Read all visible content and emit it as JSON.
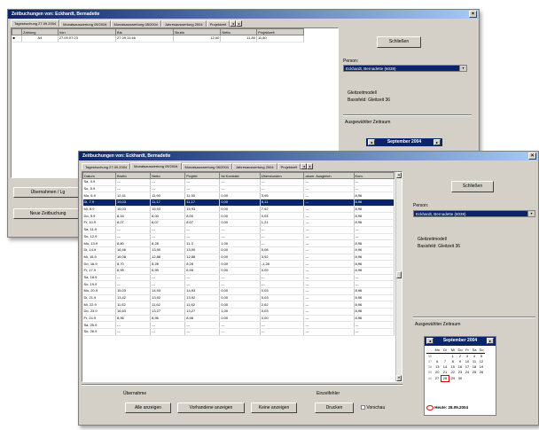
{
  "back_window": {
    "title": "Zeitbuchungen von: Eckhardt, Bernadette",
    "tabs": [
      "Tagesbuchung 27.09.2004",
      "Monatsauswertung 09/2004",
      "Monatsauswertung 08/2004",
      "Jahresauswertung 2004",
      "Projektzeit"
    ],
    "table": {
      "columns": [
        "",
        "Zahlung",
        "Von",
        "Bis",
        "Brutto",
        "Netto",
        "Projektzeit"
      ],
      "rows": [
        [
          "",
          "A4",
          "27.09.07:23",
          "27.09.11:46",
          "12,00",
          "11,80",
          "11,80"
        ]
      ]
    },
    "buttons": {
      "schliessen": "Schließen",
      "left1": "Übernahmen / Lg",
      "left2": "Neue Zeitbuchung"
    },
    "person_label": "Person:",
    "person_value": "Eckhardt, Bernadette (6038)",
    "zeitmodell_label": "Gleitzeitmodell",
    "zeitmodell_value": "Basisfeld: Gleitzeit 36",
    "calendar_label": "Ausgewählter Zeitraum",
    "calendar_month": "September 2004"
  },
  "front_window": {
    "title": "Zeitbuchungen von: Eckhardt, Bernadette",
    "tabs": [
      "Tagesbuchung 27.09.2004",
      "Monatsauswertung 09/2004",
      "Monatsauswertung 08/2004",
      "Jahresauswertung 2004",
      "Projektzeit"
    ],
    "table": {
      "columns": [
        "Datum",
        "Brutto",
        "Netto",
        "Projekt",
        "Ist Kontrakt",
        "Überstunden",
        "akum. Ausgleich",
        "Kom."
      ],
      "rows": [
        [
          "Sa, 4.9",
          "---",
          "---",
          "---",
          "---",
          "---",
          "---",
          "---"
        ],
        [
          "So, 5.9",
          "---",
          "---",
          "---",
          "---",
          "---",
          "---",
          "---"
        ],
        [
          "Mo, 6.9",
          "12,41",
          "11,90",
          "11,90",
          "0,00",
          "3,95",
          "---",
          "8,96"
        ],
        [
          "Di, 7.9",
          "19,03",
          "11,17",
          "11,17",
          "0,00",
          "8,11",
          "---",
          "8,96"
        ],
        [
          "Mi, 8.9",
          "16,03",
          "15,93",
          "15,93",
          "0,00",
          "7,92",
          "---",
          "8,96"
        ],
        [
          "Do, 9.9",
          "8,16",
          "8,00",
          "8,00",
          "0,00",
          "0,04",
          "---",
          "8,96"
        ],
        [
          "Fr, 10.9",
          "8,07",
          "8,07",
          "8,07",
          "0,00",
          "1,21",
          "---",
          "8,96"
        ],
        [
          "Sa, 11.9",
          "---",
          "---",
          "---",
          "---",
          "---",
          "---",
          "---"
        ],
        [
          "So, 12.9",
          "---",
          "---",
          "---",
          "---",
          "---",
          "---",
          "---"
        ],
        [
          "Mo, 13.9",
          "8,80",
          "8,28",
          "11,3",
          "1,00",
          "---",
          "---",
          "8,96"
        ],
        [
          "Di, 14.9",
          "16,46",
          "13,90",
          "13,90",
          "0,00",
          "5,08",
          "---",
          "8,96"
        ],
        [
          "Mi, 15.9",
          "16,08",
          "12,88",
          "12,88",
          "0,00",
          "3,92",
          "---",
          "8,96"
        ],
        [
          "Do, 16.9",
          "8,70",
          "8,28",
          "8,28",
          "0,00",
          "-1,28",
          "---",
          "8,96"
        ],
        [
          "Fr, 17.9",
          "6,95",
          "6,95",
          "6,95",
          "0,00",
          "0,09",
          "---",
          "8,96"
        ],
        [
          "Sa, 18.9",
          "---",
          "---",
          "---",
          "---",
          "---",
          "---",
          "---"
        ],
        [
          "So, 19.9",
          "---",
          "---",
          "---",
          "---",
          "---",
          "---",
          "---"
        ],
        [
          "Mo, 20.9",
          "15,03",
          "14,93",
          "14,93",
          "0,00",
          "0,03",
          "---",
          "8,96"
        ],
        [
          "Di, 21.9",
          "13,42",
          "13,92",
          "13,92",
          "0,00",
          "5,03",
          "---",
          "8,96"
        ],
        [
          "Mi, 22.9",
          "11,52",
          "11,62",
          "11,62",
          "0,00",
          "2,62",
          "---",
          "8,96"
        ],
        [
          "Do, 23.9",
          "16,63",
          "13,27",
          "13,27",
          "1,00",
          "0,03",
          "---",
          "8,96"
        ],
        [
          "Fr, 24.9",
          "8,96",
          "8,96",
          "8,96",
          "0,00",
          "0,00",
          "---",
          "8,96"
        ],
        [
          "Sa, 25.9",
          "---",
          "---",
          "---",
          "---",
          "---",
          "---",
          "---"
        ],
        [
          "So, 26.9",
          "---",
          "---",
          "---",
          "---",
          "---",
          "---",
          "---"
        ]
      ],
      "selected_row": 3
    },
    "uebernahme_label": "Übernahme",
    "einzelfehler_label": "Einzelfehler",
    "buttons": {
      "alle_anzeigen": "Alle anzeigen",
      "vorhandene_anzeigen": "Vorhandene anzeigen",
      "keine_anzeigen": "Keine anzeigen",
      "drucken": "Drucken",
      "vorschau": "Vorschau",
      "schliessen": "Schließen"
    },
    "person_label": "Person:",
    "person_value": "Eckhardt, Bernadette (6038)",
    "zeitmodell_label": "Gleitzeitmodell",
    "zeitmodell_value": "Basisfeld: Gleitzeit 36",
    "calendar_label": "Ausgewählter Zeitraum",
    "calendar": {
      "month": "September 2004",
      "weekdays": [
        "Mo",
        "Di",
        "Mi",
        "Do",
        "Fr",
        "Sa",
        "So"
      ],
      "weeks": [
        [
          "36",
          "",
          "",
          "1",
          "2",
          "3",
          "4",
          "5"
        ],
        [
          "37",
          "6",
          "7",
          "8",
          "9",
          "10",
          "11",
          "12"
        ],
        [
          "38",
          "13",
          "14",
          "15",
          "16",
          "17",
          "18",
          "19"
        ],
        [
          "39",
          "20",
          "21",
          "22",
          "23",
          "24",
          "25",
          "26"
        ],
        [
          "40",
          "27",
          "28",
          "29",
          "30",
          "",
          "",
          ""
        ]
      ],
      "today_label": "Heute: 28.09.2004"
    }
  }
}
